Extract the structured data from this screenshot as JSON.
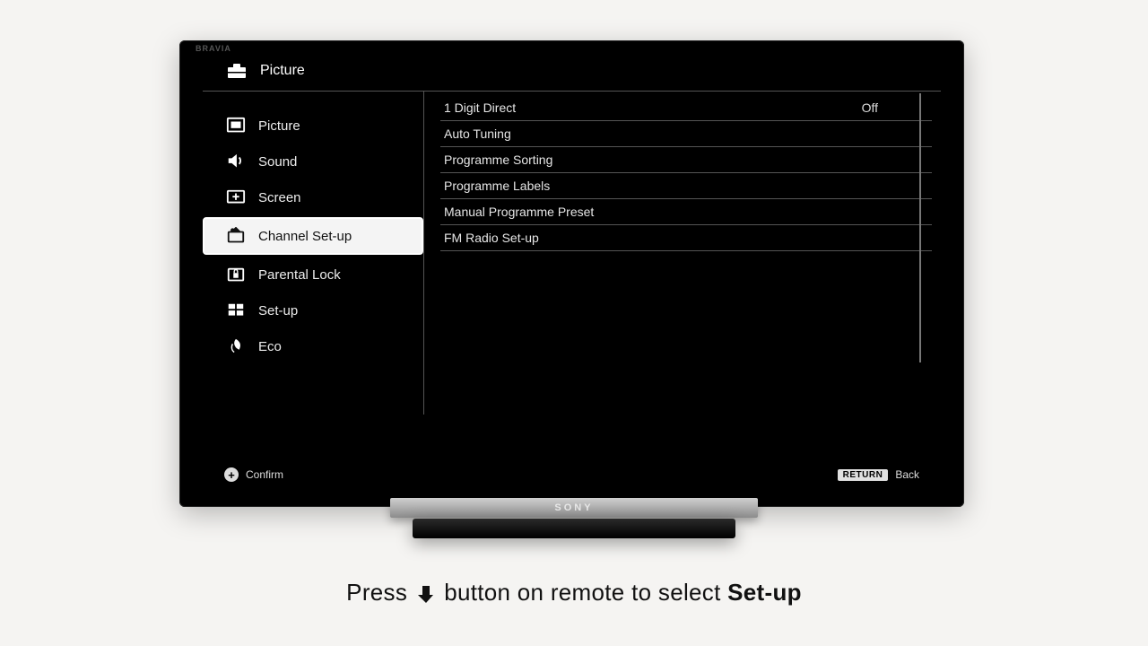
{
  "header": {
    "title": "Picture"
  },
  "sidebar": {
    "items": [
      {
        "label": "Picture"
      },
      {
        "label": "Sound"
      },
      {
        "label": "Screen"
      },
      {
        "label": "Channel Set-up"
      },
      {
        "label": "Parental Lock"
      },
      {
        "label": "Set-up"
      },
      {
        "label": "Eco"
      }
    ],
    "selected_index": 3
  },
  "detail": {
    "rows": [
      {
        "label": "1 Digit Direct",
        "value": "Off"
      },
      {
        "label": "Auto Tuning",
        "value": ""
      },
      {
        "label": "Programme Sorting",
        "value": ""
      },
      {
        "label": "Programme Labels",
        "value": ""
      },
      {
        "label": "Manual Programme Preset",
        "value": ""
      },
      {
        "label": "FM Radio Set-up",
        "value": ""
      }
    ]
  },
  "footer": {
    "confirm_label": "Confirm",
    "return_badge": "RETURN",
    "back_label": "Back"
  },
  "tv_brand": "SONY",
  "caption": {
    "prefix": "Press ",
    "suffix": " button on remote to select ",
    "target": "Set-up"
  }
}
